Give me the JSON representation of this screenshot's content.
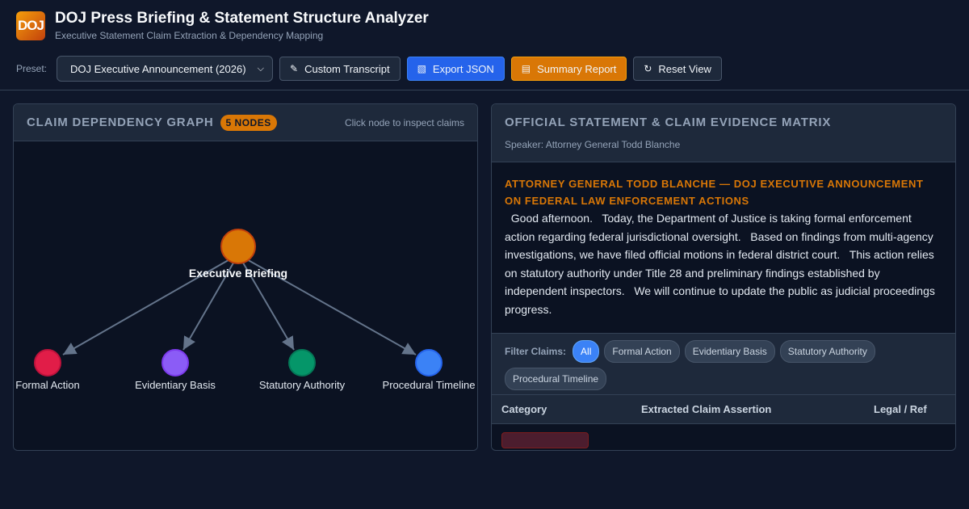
{
  "app": {
    "logo_text": "DOJ",
    "title": "DOJ Press Briefing & Statement Structure Analyzer",
    "subtitle": "Executive Statement Claim Extraction & Dependency Mapping"
  },
  "toolbar": {
    "preset_label": "Preset:",
    "preset_value": "DOJ Executive Announcement (2026)",
    "custom_label": "Custom Transcript",
    "export_label": "Export JSON",
    "summary_label": "Summary Report",
    "reset_label": "Reset View"
  },
  "graph_panel": {
    "title": "CLAIM DEPENDENCY GRAPH",
    "badge": "5 NODES",
    "hint": "Click node to inspect claims",
    "nodes": [
      {
        "label": "Executive Briefing",
        "color": "#d97706"
      },
      {
        "label": "Formal Action",
        "color": "#e11d48"
      },
      {
        "label": "Evidentiary Basis",
        "color": "#8b5cf6"
      },
      {
        "label": "Statutory Authority",
        "color": "#059669"
      },
      {
        "label": "Procedural Timeline",
        "color": "#3b82f6"
      }
    ]
  },
  "statement_panel": {
    "title": "OFFICIAL STATEMENT & CLAIM EVIDENCE MATRIX",
    "speaker": "Speaker: Attorney General Todd Blanche",
    "heading": "ATTORNEY GENERAL TODD BLANCHE — DOJ EXECUTIVE ANNOUNCEMENT ON FEDERAL LAW ENFORCEMENT ACTIONS",
    "body": "Good afternoon.   Today, the Department of Justice is taking formal enforcement action regarding federal jurisdictional oversight.   Based on findings from multi-agency investigations, we have filed official motions in federal district court.   This action relies on statutory authority under Title 28 and preliminary findings established by independent inspectors.   We will continue to update the public as judicial proceedings progress."
  },
  "filters": {
    "label": "Filter Claims:",
    "options": [
      "All",
      "Formal Action",
      "Evidentiary Basis",
      "Statutory Authority",
      "Procedural Timeline"
    ],
    "active": "All"
  },
  "table": {
    "headers": [
      "Category",
      "Extracted Claim Assertion",
      "Legal / Ref"
    ]
  }
}
